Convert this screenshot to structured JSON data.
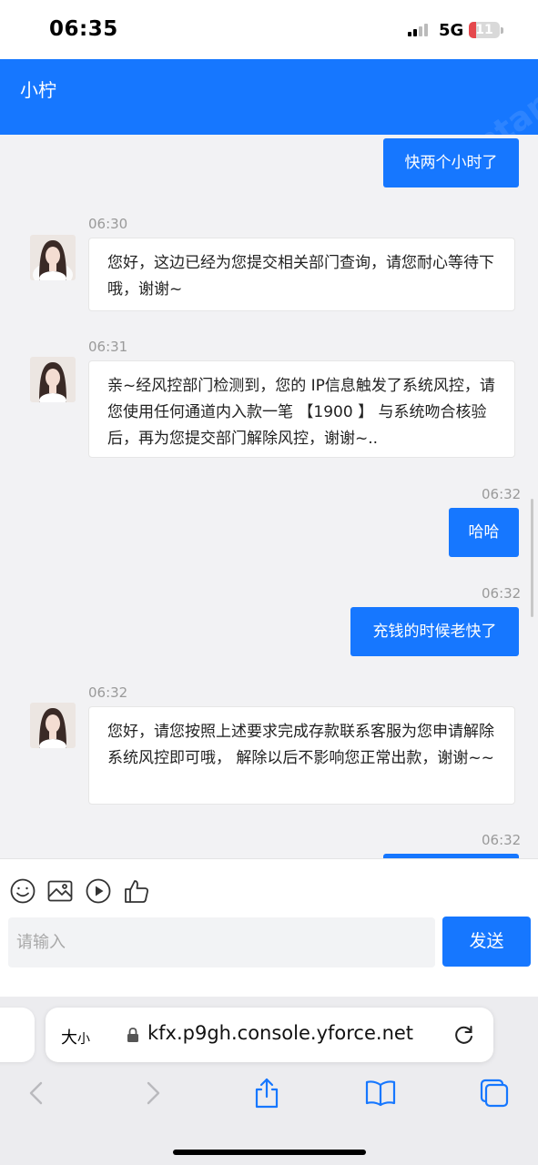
{
  "status_bar": {
    "time": "06:35",
    "network": "5G",
    "battery": "11"
  },
  "header": {
    "title": "小柠"
  },
  "watermark": "豪豪论坛 luntan.com",
  "messages": [
    {
      "type": "out",
      "text": "快两个小时了"
    },
    {
      "type": "in",
      "time": "06:30",
      "text": "您好，这边已经为您提交相关部门查询，请您耐心等待下哦，谢谢~"
    },
    {
      "type": "in",
      "time": "06:31",
      "text": "亲~经风控部门检测到，您的 IP信息触发了系统风控，请您使用任何通道内入款一笔 【1900 】 与系统吻合核验后，再为您提交部门解除风控，谢谢~.."
    },
    {
      "type": "out",
      "time": "06:32",
      "text": "哈哈"
    },
    {
      "type": "out",
      "time": "06:32",
      "text": "充钱的时候老快了"
    },
    {
      "type": "in",
      "time": "06:32",
      "text": "您好，请您按照上述要求完成存款联系客服为您申请解除系统风控即可哦， 解除以后不影响您正常出款，谢谢~~"
    },
    {
      "type": "out",
      "time": "06:32",
      "text": ""
    }
  ],
  "input": {
    "placeholder": "请输入",
    "value": "",
    "send_label": "发送"
  },
  "toolbar_icons": [
    "emoji-icon",
    "image-icon",
    "play-icon",
    "thumbs-up-icon"
  ],
  "browser": {
    "size_label_big": "大",
    "size_label_small": "小",
    "url": "kfx.p9gh.console.yforce.net"
  },
  "colors": {
    "accent": "#1677ff",
    "background": "#f2f2f4"
  }
}
